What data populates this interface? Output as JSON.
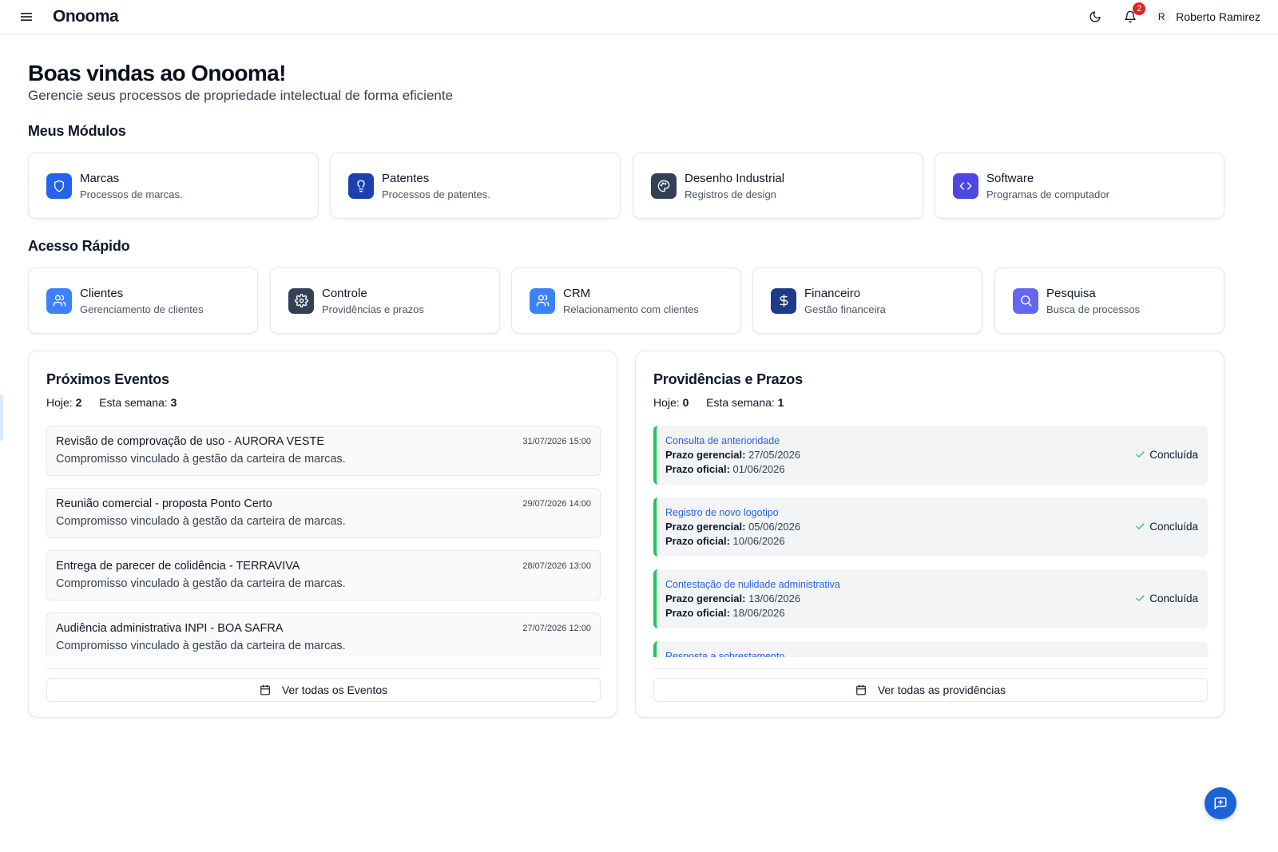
{
  "header": {
    "logo": "Onooma",
    "notifications_count": "2",
    "user_initial": "R",
    "user_name": "Roberto Ramirez"
  },
  "welcome": {
    "title": "Boas vindas ao Onooma!",
    "subtitle": "Gerencie seus processos de propriedade intelectual de forma eficiente"
  },
  "modules": {
    "title": "Meus Módulos",
    "items": [
      {
        "label": "Marcas",
        "desc": "Processos de marcas.",
        "icon": "shield-icon",
        "color": "#2563eb"
      },
      {
        "label": "Patentes",
        "desc": "Processos de patentes.",
        "icon": "lightbulb-icon",
        "color": "#1e40af"
      },
      {
        "label": "Desenho Industrial",
        "desc": "Registros de design",
        "icon": "palette-icon",
        "color": "#334155"
      },
      {
        "label": "Software",
        "desc": "Programas de computador",
        "icon": "code-icon",
        "color": "#4f46e5"
      }
    ]
  },
  "quick": {
    "title": "Acesso Rápido",
    "items": [
      {
        "label": "Clientes",
        "desc": "Gerenciamento de clientes",
        "icon": "users-icon",
        "color": "#3b82f6"
      },
      {
        "label": "Controle",
        "desc": "Providências e prazos",
        "icon": "gear-icon",
        "color": "#334155"
      },
      {
        "label": "CRM",
        "desc": "Relacionamento com clientes",
        "icon": "users-icon",
        "color": "#3b82f6"
      },
      {
        "label": "Financeiro",
        "desc": "Gestão financeira",
        "icon": "dollar-icon",
        "color": "#1e3a8a"
      },
      {
        "label": "Pesquisa",
        "desc": "Busca de processos",
        "icon": "search-icon",
        "color": "#6366f1"
      }
    ]
  },
  "events": {
    "title": "Próximos Eventos",
    "today_label": "Hoje:",
    "today_value": "2",
    "week_label": "Esta semana:",
    "week_value": "3",
    "items": [
      {
        "title": "Revisão de comprovação de uso - AURORA VESTE",
        "desc": "Compromisso vinculado à gestão da carteira de marcas.",
        "date": "31/07/2026 15:00"
      },
      {
        "title": "Reunião comercial - proposta Ponto Certo",
        "desc": "Compromisso vinculado à gestão da carteira de marcas.",
        "date": "29/07/2026 14:00"
      },
      {
        "title": "Entrega de parecer de colidência - TERRAVIVA",
        "desc": "Compromisso vinculado à gestão da carteira de marcas.",
        "date": "28/07/2026 13:00"
      },
      {
        "title": "Audiência administrativa INPI - BOA SAFRA",
        "desc": "Compromisso vinculado à gestão da carteira de marcas.",
        "date": "27/07/2026 12:00"
      }
    ],
    "view_all": "Ver todas os Eventos"
  },
  "tasks": {
    "title": "Providências e Prazos",
    "today_label": "Hoje:",
    "today_value": "0",
    "week_label": "Esta semana:",
    "week_value": "1",
    "mgr_label": "Prazo gerencial:",
    "off_label": "Prazo oficial:",
    "items": [
      {
        "title": "Consulta de anterioridade",
        "mgr": "27/05/2026",
        "off": "01/06/2026",
        "status": "Concluída"
      },
      {
        "title": "Registro de novo logotipo",
        "mgr": "05/06/2026",
        "off": "10/06/2026",
        "status": "Concluída"
      },
      {
        "title": "Contestação de nulidade administrativa",
        "mgr": "13/06/2026",
        "off": "18/06/2026",
        "status": "Concluída"
      },
      {
        "title": "Resposta a sobrestamento",
        "mgr": "",
        "off": "",
        "status": ""
      }
    ],
    "view_all": "Ver todas as providências"
  },
  "colors": {
    "accent": "#2563eb",
    "success": "#22c55e",
    "badge": "#dc2626",
    "fab": "#1d63d8"
  }
}
